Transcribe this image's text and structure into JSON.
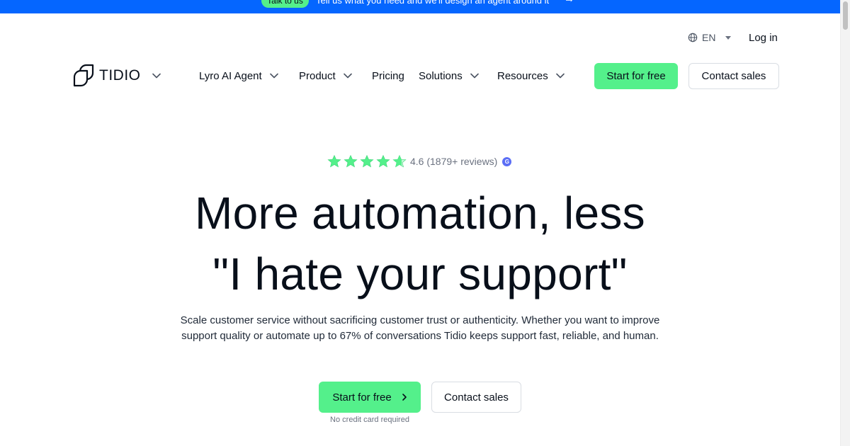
{
  "promo": {
    "pill_label": "Talk to us",
    "text": "Tell us what you need and we'll design an agent around it",
    "arrow": "→"
  },
  "utility": {
    "language": "EN",
    "login_label": "Log in"
  },
  "logo": {
    "text": "TIDIO"
  },
  "nav": {
    "items": [
      {
        "label": "Lyro AI Agent"
      },
      {
        "label": "Product"
      },
      {
        "label": "Pricing"
      },
      {
        "label": "Solutions"
      },
      {
        "label": "Resources"
      }
    ],
    "start_label": "Start for free",
    "contact_label": "Contact sales"
  },
  "hero": {
    "rating_text": "4.6 (1879+ reviews)",
    "rating_value": 4.6,
    "rating_max": 5,
    "headline_line1": "More automation, less",
    "headline_line2": "\"I hate your support\"",
    "subtext_line1": "Scale customer service without sacrificing customer trust or authenticity. Whether you want to improve",
    "subtext_line2": "support quality or automate up to 67% of conversations Tidio keeps support fast, reliable, and human.",
    "cta_primary": "Start for free",
    "cta_secondary": "Contact sales",
    "note": "No credit card required"
  },
  "colors": {
    "accent_green": "#54f08b",
    "promo_blue": "#0566ff",
    "text_dark": "#080f1a"
  }
}
